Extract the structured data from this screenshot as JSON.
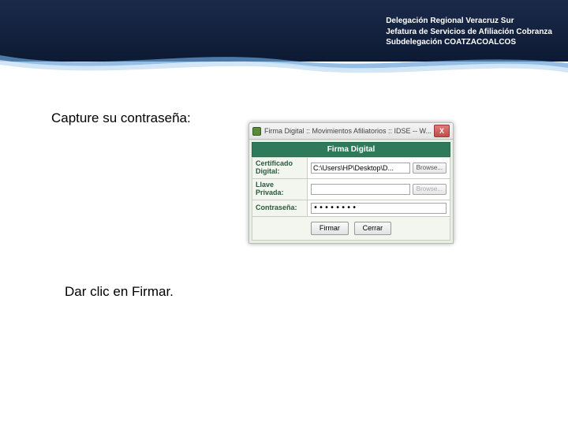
{
  "header": {
    "line1": "Delegación Regional Veracruz Sur",
    "line2": "Jefatura de Servicios de Afiliación Cobranza",
    "line3": "Subdelegación COATZACOALCOS"
  },
  "instructions": {
    "step1": "Capture su contraseña:",
    "step2": "Dar clic en Firmar."
  },
  "dialog": {
    "window_title": "Firma Digital :: Movimientos Afiliatorios :: IDSE -- W...",
    "close_x": "X",
    "title": "Firma Digital",
    "cert_label": "Certificado Digital:",
    "cert_value": "C:\\Users\\HP\\Desktop\\D...",
    "browse": "Browse...",
    "key_label": "Llave Privada:",
    "key_value": "",
    "browse2": "Browse...",
    "pwd_label": "Contraseña:",
    "pwd_mask": "••••••••",
    "btn_sign": "Firmar",
    "btn_close": "Cerrar"
  }
}
